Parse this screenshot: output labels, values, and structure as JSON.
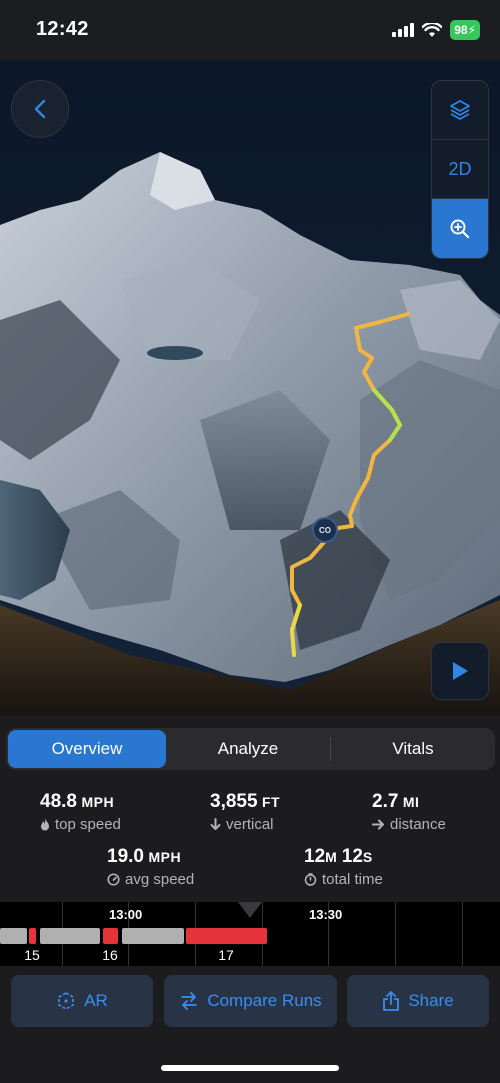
{
  "status": {
    "time": "12:42",
    "battery": "98"
  },
  "map": {
    "view_mode_label": "2D",
    "marker_label": "CO",
    "track_colors": [
      "#f2b640",
      "#e9d84a",
      "#b8e04b",
      "#f0a33a"
    ]
  },
  "tabs": [
    {
      "label": "Overview",
      "selected": true
    },
    {
      "label": "Analyze",
      "selected": false
    },
    {
      "label": "Vitals",
      "selected": false
    }
  ],
  "stats": {
    "top_speed": {
      "value": "48.8",
      "unit": "MPH",
      "label": "top speed",
      "icon": "flame-icon"
    },
    "vertical": {
      "value": "3,855",
      "unit": "FT",
      "label": "vertical",
      "icon": "arrow-down-icon"
    },
    "distance": {
      "value": "2.7",
      "unit": "MI",
      "label": "distance",
      "icon": "arrow-right-icon"
    },
    "avg_speed": {
      "value": "19.0",
      "unit": "MPH",
      "label": "avg speed",
      "icon": "gauge-icon"
    },
    "total_time": {
      "minutes": "12",
      "minutes_unit": "M",
      "seconds": "12",
      "seconds_unit": "S",
      "label": "total time",
      "icon": "stopwatch-icon"
    }
  },
  "timeline": {
    "times": [
      "13:00",
      "13:30"
    ],
    "runs": [
      "15",
      "16",
      "17"
    ],
    "colors": {
      "lift": "#b0b0b0",
      "run": "#e5343a"
    }
  },
  "actions": {
    "ar": {
      "label": "AR",
      "icon": "ar-icon"
    },
    "compare": {
      "label": "Compare Runs",
      "icon": "swap-arrows-icon"
    },
    "share": {
      "label": "Share",
      "icon": "share-icon"
    }
  }
}
